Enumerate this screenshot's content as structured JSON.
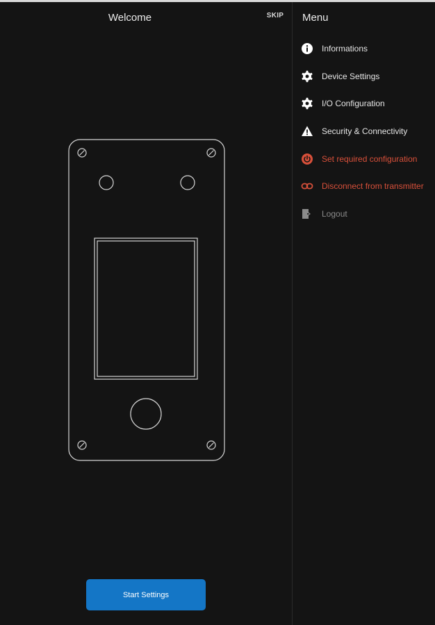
{
  "main": {
    "title": "Welcome",
    "skip_label": "SKIP",
    "start_button_label": "Start Settings"
  },
  "menu": {
    "title": "Menu",
    "items": [
      {
        "label": "Informations",
        "icon": "info-icon",
        "color": "#e6e6e6"
      },
      {
        "label": "Device Settings",
        "icon": "gear-icon",
        "color": "#e6e6e6"
      },
      {
        "label": "I/O Configuration",
        "icon": "gear-icon",
        "color": "#e6e6e6"
      },
      {
        "label": "Security & Connectivity",
        "icon": "warning-icon",
        "color": "#e6e6e6"
      },
      {
        "label": "Set required configuration",
        "icon": "power-icon",
        "color": "#d8503a"
      },
      {
        "label": "Disconnect from transmitter",
        "icon": "link-icon",
        "color": "#d8503a"
      },
      {
        "label": "Logout",
        "icon": "logout-icon",
        "color": "#8a8a8a"
      }
    ]
  },
  "colors": {
    "background": "#141414",
    "accent": "#1476c6",
    "danger": "#d8503a",
    "muted": "#8a8a8a"
  }
}
